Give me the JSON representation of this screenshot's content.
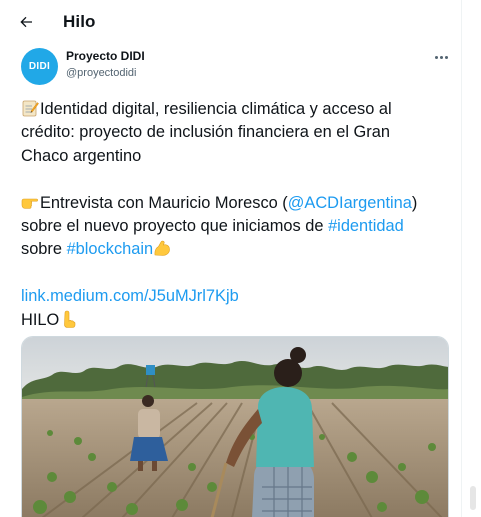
{
  "header": {
    "title": "Hilo"
  },
  "author": {
    "avatar_text": "DIDI",
    "name": "Proyecto DIDI",
    "handle": "@proyectodidi"
  },
  "tweet": {
    "line1": "Identidad digital, resiliencia climática y acceso al",
    "line2": "crédito: proyecto de inclusión financiera en el Gran",
    "line3": "Chaco argentino",
    "line4_a": "Entrevista con Mauricio Moresco (",
    "line4_mention": "@ACDIargentina",
    "line4_b": ")",
    "line5_a": "sobre el nuevo proyecto que iniciamos de ",
    "line5_hashtag": "#identidad",
    "line6_a": "sobre ",
    "line6_hashtag": "#blockchain",
    "link": "link.medium.com/J5uMJrl7Kjb",
    "hilo": "HILO"
  },
  "icons": {
    "back": "arrow-left-icon",
    "more": "more-horizontal-icon",
    "memo": "memo-emoji",
    "point_right": "backhand-index-pointing-right-emoji",
    "flexed_biceps": "flexed-biceps-emoji",
    "point_down": "backhand-index-pointing-down-emoji"
  },
  "colors": {
    "link": "#1d9bf0",
    "avatar_bg": "#21a8e7",
    "text": "#0f1419",
    "secondary": "#536471"
  }
}
